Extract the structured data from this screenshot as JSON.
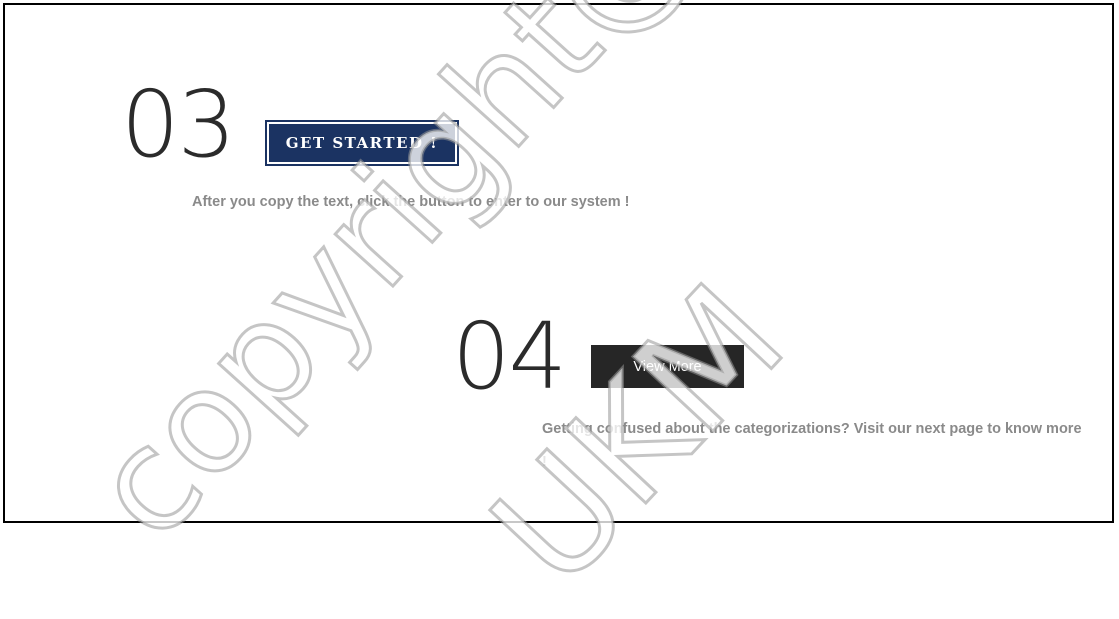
{
  "step3": {
    "number": "03",
    "button_label": "GET STARTED !",
    "description": "After you copy the text, click the button to enter to our system !"
  },
  "step4": {
    "number": "04",
    "button_label": "View More",
    "description": "Getting confused about the categorizations? Visit our next page to know more !"
  },
  "watermark": {
    "line1": "copyright@",
    "line2": "UKM"
  },
  "colors": {
    "primary_button": "#1b3362",
    "secondary_button": "#262626",
    "text_muted": "#8a8a8a",
    "number_text": "#2b2b2b"
  }
}
